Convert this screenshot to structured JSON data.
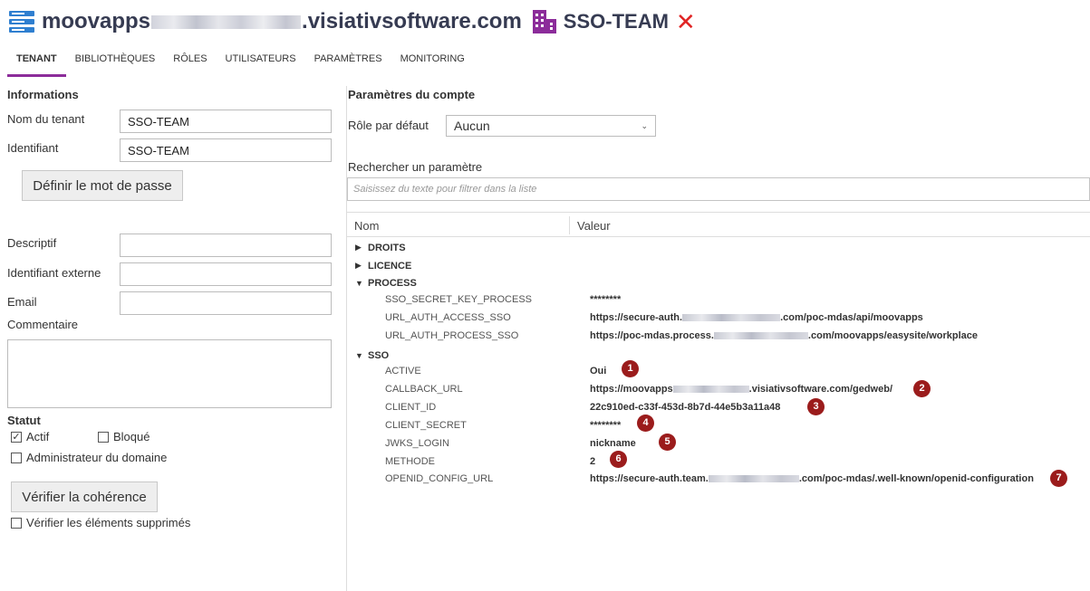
{
  "header": {
    "host_prefix": "moovapps",
    "host_suffix": ".visiativsoftware.com",
    "tenant": "SSO-TEAM",
    "close_glyph": "✕"
  },
  "tabs": [
    {
      "label": "TENANT",
      "active": true
    },
    {
      "label": "BIBLIOTHÈQUES"
    },
    {
      "label": "RÔLES"
    },
    {
      "label": "UTILISATEURS"
    },
    {
      "label": "PARAMÈTRES"
    },
    {
      "label": "MONITORING"
    }
  ],
  "informations": {
    "title": "Informations",
    "nom_label": "Nom du tenant",
    "nom_value": "SSO-TEAM",
    "id_label": "Identifiant",
    "id_value": "SSO-TEAM",
    "password_button": "Définir le mot de passe",
    "descriptif_label": "Descriptif",
    "ext_id_label": "Identifiant externe",
    "email_label": "Email",
    "commentaire_label": "Commentaire"
  },
  "statut": {
    "title": "Statut",
    "actif_label": "Actif",
    "actif_checked": "✓",
    "bloque_label": "Bloqué",
    "admin_label": "Administrateur du domaine",
    "verify_button": "Vérifier la cohérence",
    "verify_deleted_label": "Vérifier les éléments supprimés"
  },
  "compte": {
    "title": "Paramètres du compte",
    "role_label": "Rôle par défaut",
    "role_value": "Aucun",
    "search_label": "Rechercher un paramètre",
    "search_placeholder": "Saisissez du texte pour filtrer dans la liste"
  },
  "grid": {
    "col_name": "Nom",
    "col_value": "Valeur",
    "groups": {
      "droits": "DROITS",
      "licence": "LICENCE",
      "process": "PROCESS",
      "sso": "SSO"
    },
    "process_rows": [
      {
        "name": "SSO_SECRET_KEY_PROCESS",
        "value": "********"
      },
      {
        "name": "URL_AUTH_ACCESS_SSO",
        "value_a": "https://secure-auth.",
        "value_b": ".com/poc-mdas/api/moovapps"
      },
      {
        "name": "URL_AUTH_PROCESS_SSO",
        "value_a": "https://poc-mdas.process.",
        "value_b": ".com/moovapps/easysite/workplace"
      }
    ],
    "sso_rows": [
      {
        "name": "ACTIVE",
        "value": "Oui",
        "marker": "1"
      },
      {
        "name": "CALLBACK_URL",
        "value_a": "https://moovapps",
        "value_b": ".visiativsoftware.com/gedweb/",
        "marker": "2"
      },
      {
        "name": "CLIENT_ID",
        "value": "22c910ed-c33f-453d-8b7d-44e5b3a11a48",
        "marker": "3"
      },
      {
        "name": "CLIENT_SECRET",
        "value": "********",
        "marker": "4"
      },
      {
        "name": "JWKS_LOGIN",
        "value": "nickname",
        "marker": "5"
      },
      {
        "name": "METHODE",
        "value": "2",
        "marker": "6"
      },
      {
        "name": "OPENID_CONFIG_URL",
        "value_a": "https://secure-auth.team.",
        "value_b": ".com/poc-mdas/.well-known/openid-configuration",
        "marker": "7"
      }
    ]
  },
  "colors": {
    "accent": "#8c2c9a",
    "marker": "#9b1c1c",
    "close": "#e02424",
    "server_icon": "#2f7fd0"
  },
  "icons": {
    "server": "server-icon",
    "tenant": "building-icon",
    "close": "close-icon"
  }
}
